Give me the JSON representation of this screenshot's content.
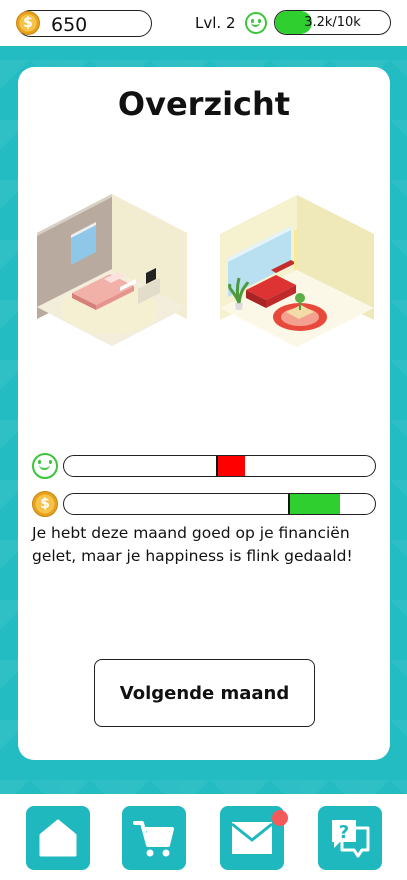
{
  "header": {
    "coins": "650",
    "coin_symbol": "$",
    "level_label": "Lvl. 2",
    "xp_text": "3.2k/10k",
    "xp_progress": 0.32
  },
  "card": {
    "title": "Overzicht",
    "happiness_meter": {
      "icon": "smiley-icon",
      "marker_color": "#ff0000",
      "marker_level": 0.49
    },
    "money_meter": {
      "icon": "coin-icon",
      "marker_color": "#2fcf2f",
      "marker_level": 0.72
    },
    "message": "Je hebt deze maand goed op je financiën gelet, maar je happiness is flink gedaald!",
    "next_button_label": "Volgende maand"
  },
  "nav": {
    "items": [
      {
        "icon": "home-icon"
      },
      {
        "icon": "cart-icon"
      },
      {
        "icon": "mail-icon",
        "has_notification": true
      },
      {
        "icon": "help-chat-icon"
      }
    ]
  },
  "colors": {
    "accent": "#1fb8bf",
    "success": "#2fcf2f",
    "danger": "#ff0000",
    "notification": "#f55a5a"
  }
}
